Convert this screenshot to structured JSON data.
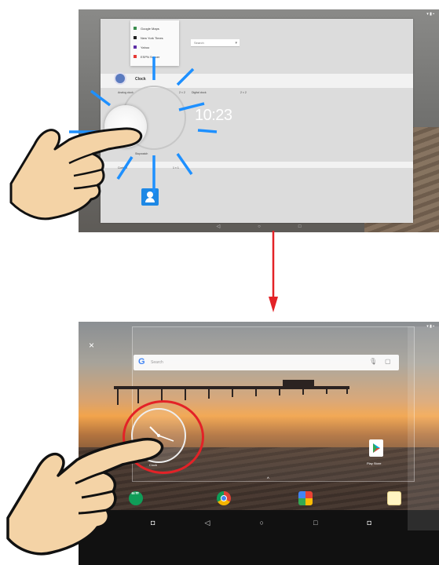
{
  "top_screen": {
    "shortcut_menu": [
      "Google Maps",
      "New York Times",
      "Yahoo",
      "ESPN Soccer"
    ],
    "shortcut_colors": [
      "#3b8e4e",
      "#222222",
      "#5d2ea6",
      "#e53935"
    ],
    "search_select": "Search",
    "section_title": "Clock",
    "analog_label": "Analog clock",
    "analog_size": "2 × 2",
    "digital_label": "Digital clock",
    "digital_size": "2 × 2",
    "digital_time": "10:23",
    "stopwatch_label": "Stopwatch",
    "contact_label": "Contact",
    "contact_size": "1 × 1",
    "nav_back": "◁",
    "nav_home": "○",
    "nav_recent": "□"
  },
  "bottom_screen": {
    "close_label": "×",
    "search_placeholder": "Search",
    "google_g": "G",
    "clock_label": "Clock",
    "play_store_label": "Play Store",
    "up_chevron": "^",
    "nav_back": "◁",
    "nav_home": "○",
    "nav_recent": "□"
  },
  "colors": {
    "arrow": "#e32227",
    "press_rays": "#1e90ff",
    "highlight_ring": "#e32227",
    "skin": "#f4d3a6"
  },
  "icons": [
    "wifi-icon",
    "battery-icon",
    "search-icon",
    "mic-icon",
    "screenshot-icon",
    "contact-icon",
    "hangouts-icon",
    "chrome-icon",
    "photos-icon",
    "camera-icon",
    "play-store-icon",
    "close-icon",
    "back-icon",
    "home-icon",
    "recent-apps-icon"
  ]
}
